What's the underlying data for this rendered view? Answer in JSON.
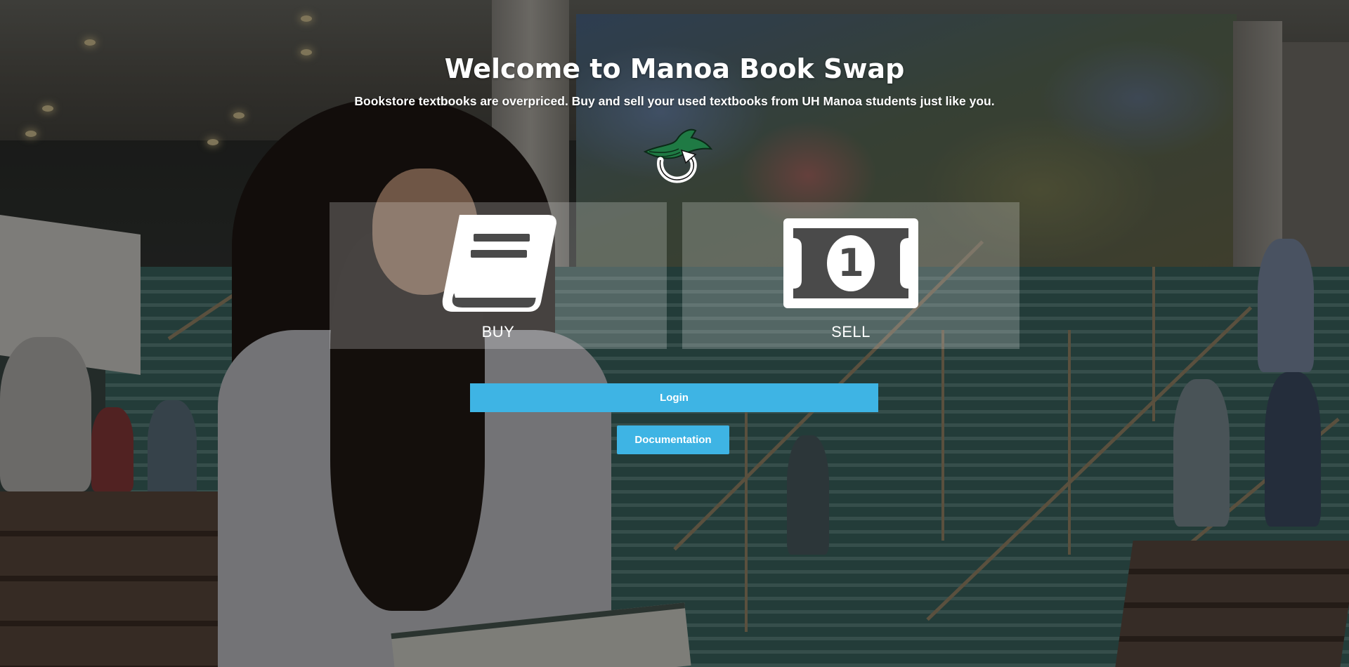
{
  "hero": {
    "title": "Welcome to Manoa Book Swap",
    "subtitle": "Bookstore textbooks are overpriced. Buy and sell your used textbooks from UH Manoa students just like you."
  },
  "logo": {
    "icon": "book-swap-logo-icon",
    "color": "#1f7a44"
  },
  "tiles": [
    {
      "label": "BUY",
      "icon": "book-icon"
    },
    {
      "label": "SELL",
      "icon": "dollar-bill-icon",
      "bill_denomination": "1"
    }
  ],
  "actions": {
    "login_label": "Login",
    "documentation_label": "Documentation"
  },
  "colors": {
    "primary_button": "#3eb4e4",
    "tile_overlay": "rgba(255,255,255,0.22)",
    "text": "#ffffff"
  }
}
